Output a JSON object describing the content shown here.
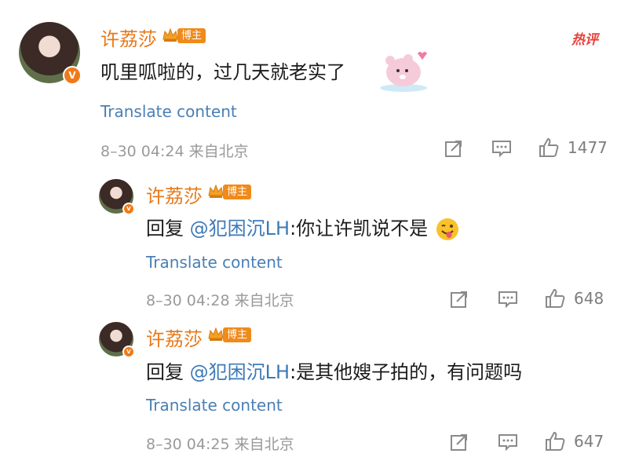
{
  "hot_label": "热评",
  "comments": [
    {
      "name": "许荔莎",
      "badge": "博主",
      "text": "叽里呱啦的，过几天就老实了",
      "translate": "Translate content",
      "time": "8–30 04:24 来自北京",
      "likes": "1477"
    },
    {
      "name": "许荔莎",
      "badge": "博主",
      "reply_prefix": "回复 ",
      "mention": "@犯困沉LH",
      "text": ":你让许凯说不是",
      "translate": "Translate content",
      "time": "8–30 04:28 来自北京",
      "likes": "648"
    },
    {
      "name": "许荔莎",
      "badge": "博主",
      "reply_prefix": "回复 ",
      "mention": "@犯困沉LH",
      "text": ":是其他嫂子拍的，有问题吗",
      "translate": "Translate content",
      "time": "8–30 04:25 来自北京",
      "likes": "647"
    }
  ],
  "colors": {
    "name": "#e8791a",
    "link": "#4a7fb4",
    "meta": "#9a9a9a",
    "hot": "#e9413b"
  },
  "icons": [
    "verified-icon",
    "crown-icon",
    "share-icon",
    "comment-icon",
    "like-icon",
    "sticker-icon",
    "tongue-emoji-icon"
  ]
}
